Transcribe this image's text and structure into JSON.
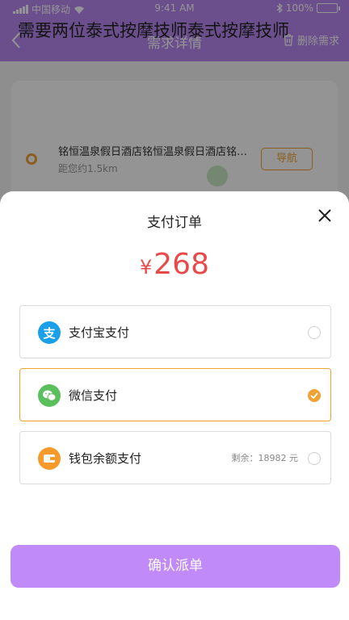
{
  "status_bar": {
    "carrier": "中国移动",
    "time": "9:41 AM",
    "battery": "100%"
  },
  "navbar": {
    "title": "需求详情",
    "delete_label": "删除需求"
  },
  "demand_card": {
    "title": "需要两位泰式按摩技师泰式按摩技师",
    "location_name": "铭恒温泉假日酒店铭恒温泉假日酒店铭恒温泉假日酒店",
    "distance": "距您约1.5km",
    "navigate_label": "导航"
  },
  "payment_sheet": {
    "title": "支付订单",
    "currency_symbol": "¥",
    "amount": "268",
    "options": [
      {
        "label": "支付宝支付",
        "icon": "alipay-icon",
        "icon_text": "支",
        "icon_color": "#1aa0e8",
        "selected": false
      },
      {
        "label": "微信支付",
        "icon": "wechat-icon",
        "icon_color": "#5bbf5e",
        "selected": true
      },
      {
        "label": "钱包余额支付",
        "icon": "wallet-icon",
        "icon_color": "#f59a2b",
        "selected": false,
        "balance_text": "剩余：18982 元"
      }
    ],
    "confirm_label": "确认派单"
  },
  "colors": {
    "brand_purple": "#b988f3",
    "confirm_button": "#c08af8",
    "accent_orange": "#f0a233",
    "price_red": "#e84a4a"
  }
}
